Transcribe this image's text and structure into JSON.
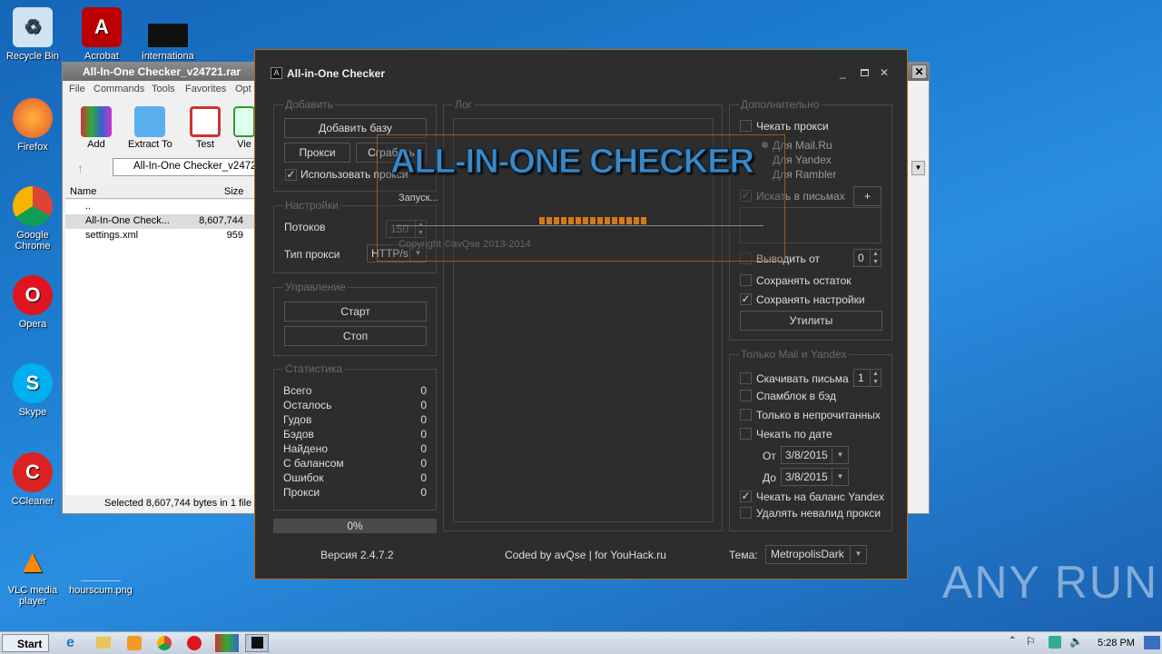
{
  "desktop": {
    "icons": [
      {
        "label": "Recycle Bin",
        "icon": "recycle-bin-icon"
      },
      {
        "label": "Acrobat",
        "icon": "acrobat-icon"
      },
      {
        "label": "internationa",
        "icon": "file-icon"
      },
      {
        "label": "Firefox",
        "icon": "firefox-icon"
      },
      {
        "label": "Google Chrome",
        "icon": "chrome-icon"
      },
      {
        "label": "Opera",
        "icon": "opera-icon"
      },
      {
        "label": "Skype",
        "icon": "skype-icon"
      },
      {
        "label": "CCleaner",
        "icon": "ccleaner-icon"
      },
      {
        "label": "VLC media player",
        "icon": "vlc-icon"
      },
      {
        "label": "hourscum.png",
        "icon": "image-icon"
      }
    ],
    "watermark": "ANY RUN"
  },
  "winrar": {
    "title": "All-In-One Checker_v24721.rar",
    "menu": [
      "File",
      "Commands",
      "Tools",
      "Favorites",
      "Opt"
    ],
    "toolbar": [
      "Add",
      "Extract To",
      "Test",
      "Vie"
    ],
    "address": "All-In-One Checker_v24721",
    "columns": [
      "Name",
      "Size"
    ],
    "files": [
      {
        "name": "..",
        "size": ""
      },
      {
        "name": "All-In-One Check...",
        "size": "8,607,744"
      },
      {
        "name": "settings.xml",
        "size": "959"
      }
    ],
    "status": "Selected 8,607,744 bytes in 1 file"
  },
  "app": {
    "title": "All-in-One Checker",
    "add": {
      "title": "Добавить",
      "add_base": "Добавить базу",
      "proxy": "Прокси",
      "grab": "Сграбить",
      "use_proxy": "Использовать прокси"
    },
    "settings": {
      "title": "Настройки",
      "threads_label": "Потоков",
      "threads": "150",
      "proxy_type_label": "Тип прокси",
      "proxy_type": "HTTP/s"
    },
    "control": {
      "title": "Управление",
      "start": "Старт",
      "stop": "Стоп"
    },
    "stats": {
      "title": "Статистика",
      "rows": [
        {
          "k": "Всего",
          "v": "0"
        },
        {
          "k": "Осталось",
          "v": "0"
        },
        {
          "k": "Гудов",
          "v": "0"
        },
        {
          "k": "Бэдов",
          "v": "0"
        },
        {
          "k": "Найдено",
          "v": "0"
        },
        {
          "k": "С балансом",
          "v": "0"
        },
        {
          "k": "Ошибок",
          "v": "0"
        },
        {
          "k": "Прокси",
          "v": "0"
        }
      ]
    },
    "progress": "0%",
    "log": {
      "title": "Лог"
    },
    "extra": {
      "title": "Дополнительно",
      "check_proxy": "Чекать прокси",
      "radios": [
        "Для Mail.Ru",
        "Для Yandex",
        "Для Rambler"
      ],
      "search_mail": "Искать в письмах",
      "plus": "+",
      "output_from": "Выводить от",
      "output_from_value": "0",
      "save_rest": "Сохранять остаток",
      "save_settings": "Сохранять настройки",
      "utils": "Утилиты"
    },
    "mailyandex": {
      "title": "Только Mail и Yandex",
      "download": "Скачивать письма",
      "download_value": "1",
      "spamblock": "Спамблок в бэд",
      "unread": "Только в непрочитанных",
      "by_date": "Чекать по дате",
      "from_label": "От",
      "from": "3/8/2015",
      "to_label": "До",
      "to": "3/8/2015",
      "balance": "Чекать на баланс Yandex",
      "delete_invalid": "Удалять невалид прокси"
    },
    "footer": {
      "version": "Версия 2.4.7.2",
      "coded": "Coded by avQse | for YouHack.ru",
      "theme_label": "Тема:",
      "theme": "MetropolisDark"
    },
    "splash": {
      "logo": "ALL-IN-ONE CHECKER",
      "loading": "Запуск...",
      "copyright": "Copyright ©avQse  2013-2014",
      "accent": "#d47a1a"
    }
  },
  "taskbar": {
    "start": "Start",
    "clock": "5:28 PM"
  }
}
